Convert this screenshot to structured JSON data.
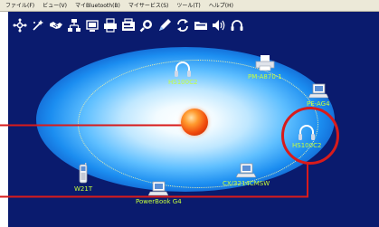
{
  "menu": [
    "ファイル(F)",
    "ビュー(V)",
    "マイBluetooth(B)",
    "マイサービス(S)",
    "ツール(T)",
    "ヘルプ(H)"
  ],
  "toolbar": [
    "connect-icon",
    "wizard-icon",
    "handshake-icon",
    "network-icon",
    "file-transfer-icon",
    "print-icon",
    "fax-icon",
    "search-icon",
    "pen-icon",
    "sync-icon",
    "folder-icon",
    "speaker-icon",
    "headset-icon"
  ],
  "devices": [
    {
      "label": "HS100C2",
      "icon": "headset-icon"
    },
    {
      "label": "PM-A870-1",
      "icon": "printer-icon"
    },
    {
      "label": "PE-AG4",
      "icon": "laptop-icon"
    },
    {
      "label": "HS100C2",
      "icon": "headset-icon"
    },
    {
      "label": "CX/3214CMSW",
      "icon": "laptop-icon"
    },
    {
      "label": "PowerBook G4",
      "icon": "laptop-icon"
    },
    {
      "label": "W21T",
      "icon": "mobile-phone-icon"
    }
  ],
  "colors": {
    "background": "#0a1b6e",
    "label": "#c6ff3c",
    "callout": "#d81b1b",
    "orbit": "#e8f0b0"
  }
}
